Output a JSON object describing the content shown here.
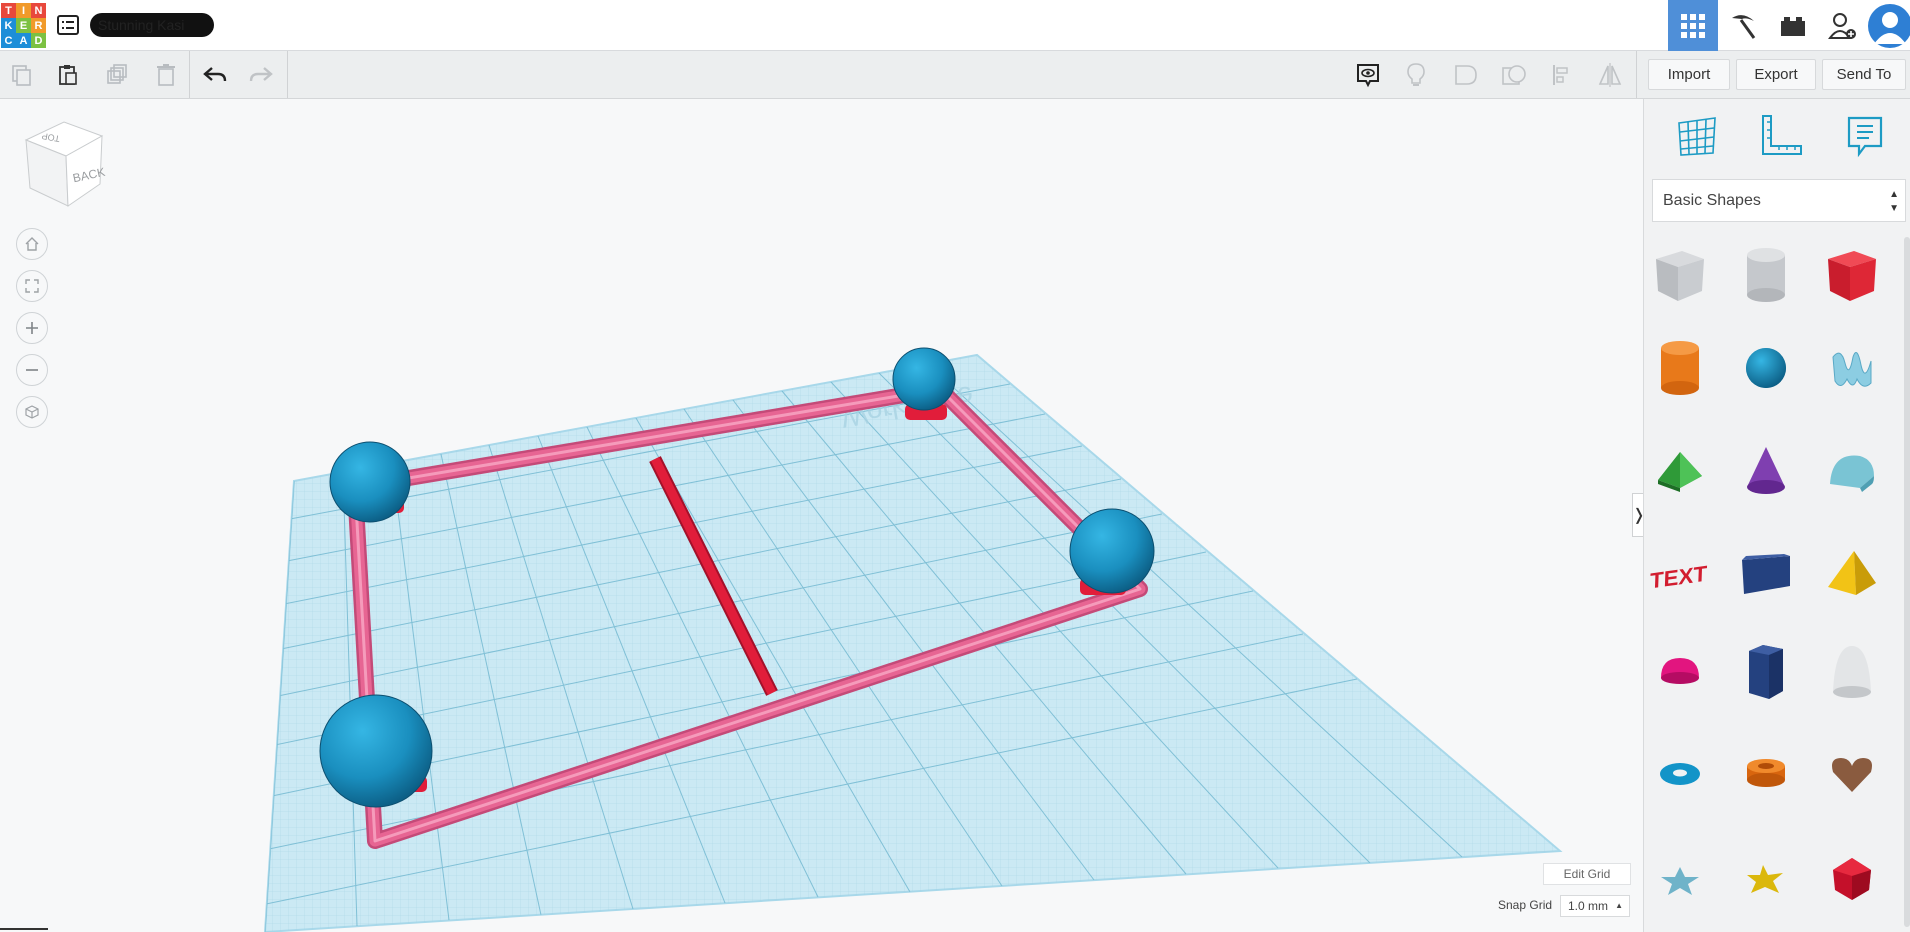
{
  "app": {
    "logo_letters": [
      "T",
      "I",
      "N",
      "K",
      "E",
      "R",
      "C",
      "A",
      "D"
    ],
    "project_name": "Stunning Kasi"
  },
  "header": {
    "view_buttons": [
      "grid-view-icon",
      "pickaxe-icon",
      "bricks-icon",
      "add-user-icon",
      "avatar"
    ],
    "active": "grid-view-icon",
    "accent_color": "#4f8fd8"
  },
  "toolbar": {
    "left_tools": [
      "copy-icon",
      "paste-icon",
      "duplicate-icon",
      "delete-icon",
      "undo-icon",
      "redo-icon"
    ],
    "right_tools": [
      "notes-toggle-icon",
      "light-bulb-icon",
      "solid-shape-icon",
      "hole-shape-icon",
      "align-icon",
      "mirror-icon"
    ],
    "import_label": "Import",
    "export_label": "Export",
    "send_to_label": "Send To"
  },
  "viewport": {
    "viewcube_top": "TOP",
    "viewcube_back": "BACK",
    "workplane_text": "Workplane",
    "nav_buttons": [
      "home-view-icon",
      "fit-view-icon",
      "zoom-in-icon",
      "zoom-out-icon",
      "ortho-view-icon"
    ],
    "edit_grid_label": "Edit Grid",
    "snap_grid_label": "Snap Grid",
    "snap_grid_value": "1.0 mm",
    "workplane_color": "#cbe9f4",
    "frame_color": "#e76593",
    "sphere_color": "#1a8fbf"
  },
  "panel": {
    "tools": [
      "workplane-icon",
      "ruler-icon",
      "notes-icon"
    ],
    "shape_library": "Basic Shapes",
    "shapes": [
      "box-hole-icon",
      "cylinder-hole-icon",
      "box-icon",
      "cylinder-icon",
      "sphere-icon",
      "scribble-icon",
      "roof-icon",
      "cone-icon",
      "round-roof-icon",
      "text-icon",
      "wedge-icon",
      "pyramid-icon",
      "half-sphere-icon",
      "polygon-icon",
      "paraboloid-icon",
      "torus-icon",
      "tube-icon",
      "heart-icon",
      "star-icon",
      "yellow-star-icon",
      "icosahedron-icon"
    ]
  }
}
